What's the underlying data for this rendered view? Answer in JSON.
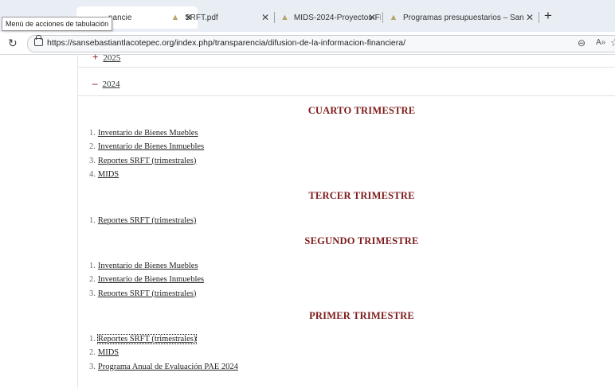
{
  "browser": {
    "tooltip": "Menú de acciones de tabulación",
    "tabs": [
      {
        "title": "nancie"
      },
      {
        "title": "SRFT.pdf"
      },
      {
        "title": "MIDS-2024-Proyectos-FISMDF1-1"
      },
      {
        "title": "Programas presupuestarios – San"
      }
    ],
    "new_tab": "+",
    "url": "https://sansebastiantlacotepec.org/index.php/transparencia/difusion-de-la-informacion-financiera/"
  },
  "page": {
    "years": [
      {
        "sign": "+",
        "label": "2025"
      },
      {
        "sign": "–",
        "label": "2024"
      }
    ],
    "sections": [
      {
        "heading": "CUARTO TRIMESTRE",
        "items": [
          {
            "num": "1.",
            "label": "Inventario de Bienes Muebles"
          },
          {
            "num": "2.",
            "label": "Inventario de Bienes Inmuebles"
          },
          {
            "num": "3.",
            "label": "Reportes SRFT (trimestrales)"
          },
          {
            "num": "4.",
            "label": "MIDS"
          }
        ]
      },
      {
        "heading": "TERCER TRIMESTRE",
        "items": [
          {
            "num": "1.",
            "label": "Reportes SRFT (trimestrales)"
          }
        ]
      },
      {
        "heading": "SEGUNDO TRIMESTRE",
        "items": [
          {
            "num": "1.",
            "label": "Inventario de Bienes Muebles"
          },
          {
            "num": "2.",
            "label": "Inventario de Bienes Inmuebles"
          },
          {
            "num": "3.",
            "label": "Reportes SRFT (trimestrales)"
          }
        ]
      },
      {
        "heading": "PRIMER TRIMESTRE",
        "items": [
          {
            "num": "1.",
            "label": "Reportes SRFT (trimestrales)"
          },
          {
            "num": "2.",
            "label": "MIDS"
          },
          {
            "num": "3.",
            "label": "Programa Anual de Evaluación PAE 2024"
          }
        ]
      }
    ]
  }
}
